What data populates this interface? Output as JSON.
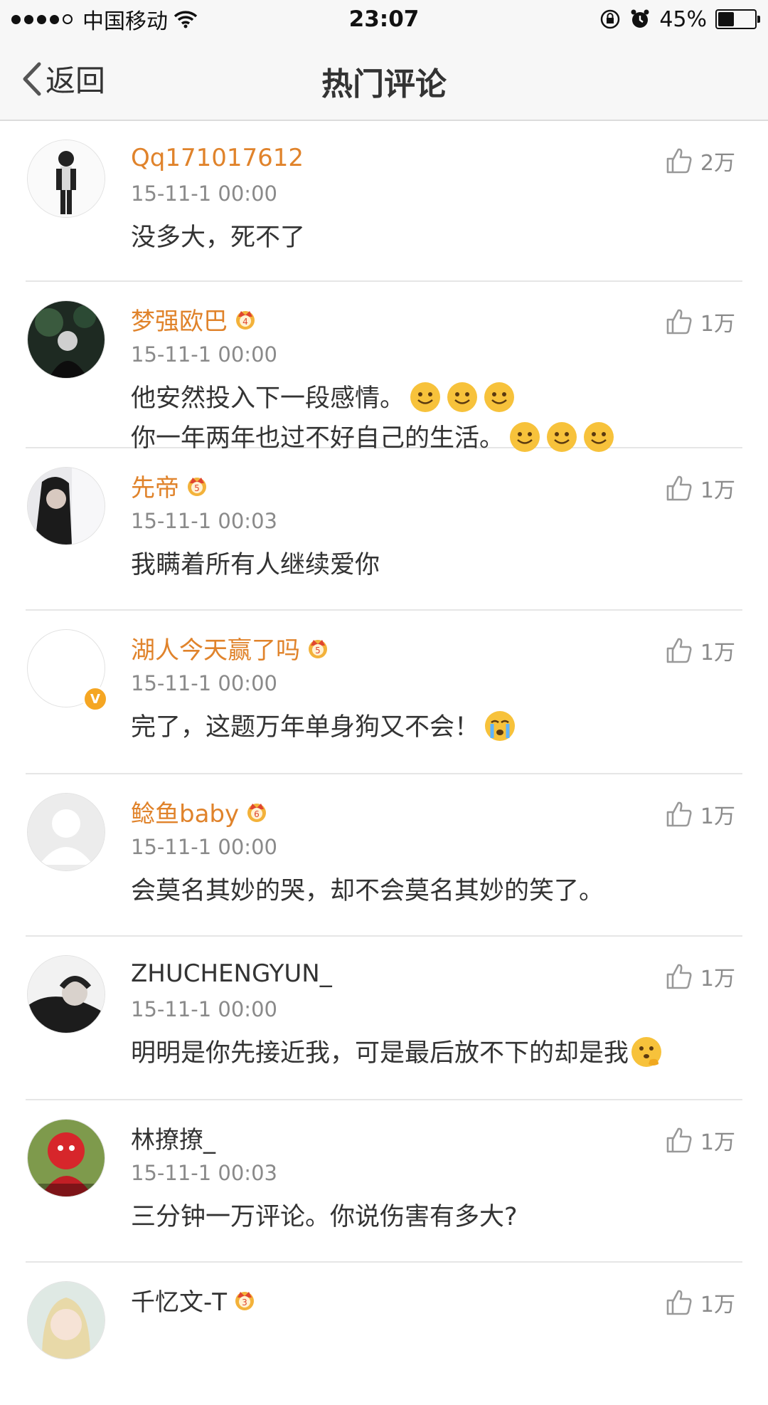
{
  "status_bar": {
    "carrier": "中国移动",
    "time": "23:07",
    "battery": "45%",
    "battery_level": 0.45
  },
  "nav": {
    "back_label": "返回",
    "title": "热门评论"
  },
  "comments": [
    {
      "name": "Qq171017612",
      "time": "15-11-1 00:00",
      "text": "没多大，死不了",
      "likes": "2万"
    },
    {
      "name": "梦强欧巴",
      "time": "15-11-1 00:00",
      "text": "他安然投入下一段感情。",
      "text2": "你一年两年也过不好自己的生活。",
      "likes": "1万"
    },
    {
      "name": "先帝",
      "time": "15-11-1 00:03",
      "text": "我瞒着所有人继续爱你",
      "likes": "1万"
    },
    {
      "name": "湖人今天赢了吗",
      "time": "15-11-1 00:00",
      "text": "完了，这题万年单身狗又不会！",
      "likes": "1万"
    },
    {
      "name": "鲶鱼baby",
      "time": "15-11-1 00:00",
      "text": "会莫名其妙的哭，却不会莫名其妙的笑了。",
      "likes": "1万"
    },
    {
      "name": "ZHUCHENGYUN_",
      "time": "15-11-1 00:00",
      "text": "明明是你先接近我，可是最后放不下的却是我",
      "likes": "1万"
    },
    {
      "name": "林撩撩_",
      "time": "15-11-1 00:03",
      "text": "三分钟一万评论。你说伤害有多大?",
      "likes": "1万"
    },
    {
      "name": "千忆文-T",
      "likes": "1万"
    }
  ]
}
